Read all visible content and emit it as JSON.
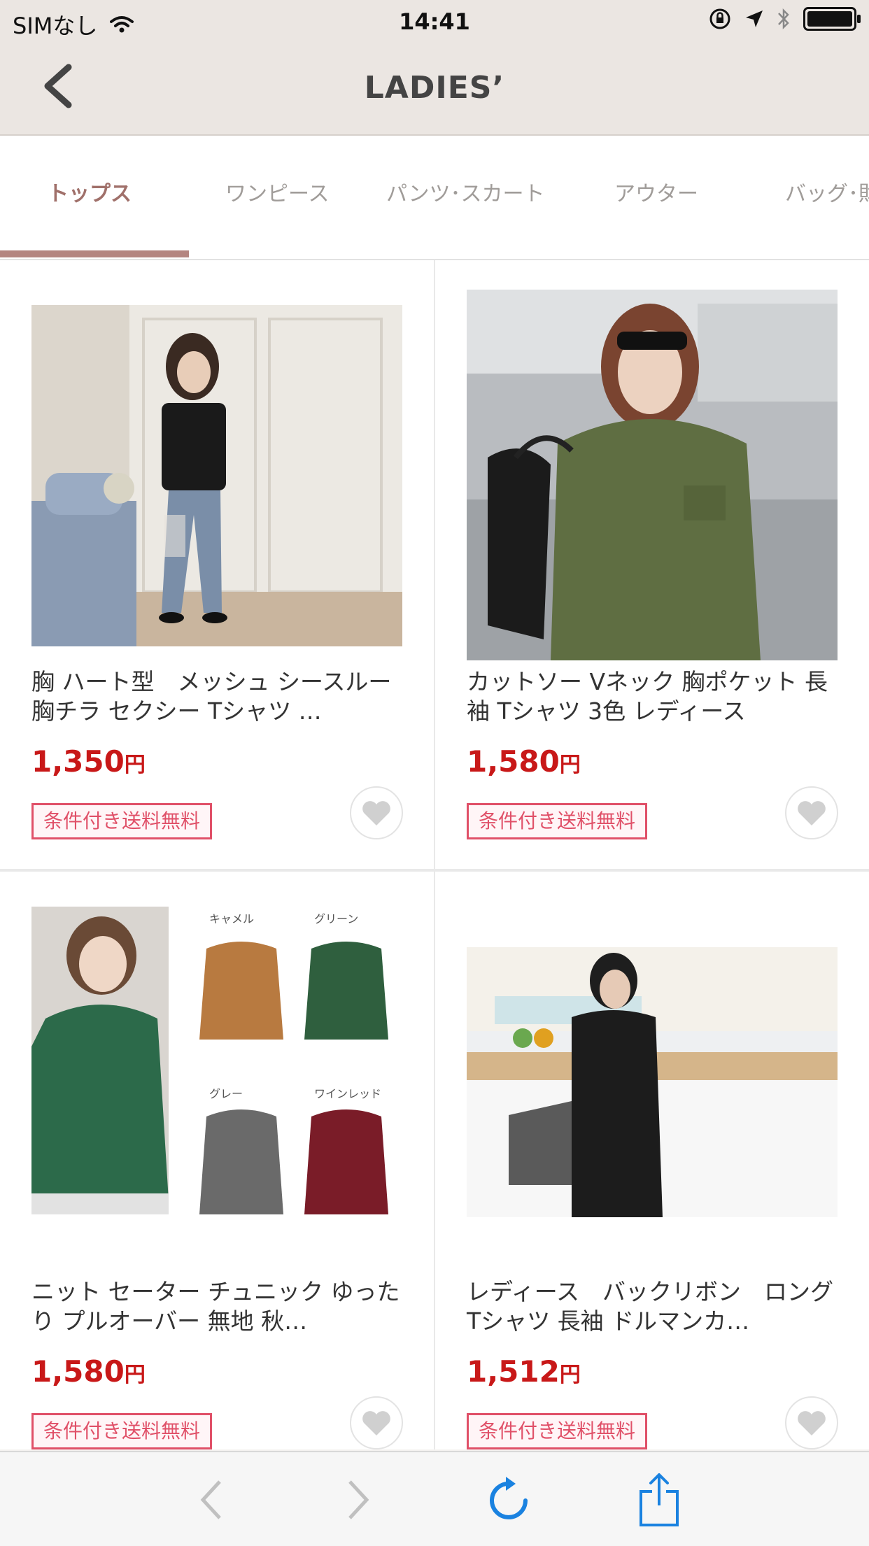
{
  "status": {
    "carrier": "SIMなし",
    "time": "14:41"
  },
  "nav": {
    "title": "LADIES’"
  },
  "tabs": [
    {
      "label": "トップス",
      "active": true
    },
    {
      "label": "ワンピース"
    },
    {
      "label": "パンツ･スカート"
    },
    {
      "label": "アウター"
    },
    {
      "label": "バッグ･財"
    }
  ],
  "products": [
    {
      "title": "胸 ハート型　メッシュ シースルー 胸チラ セクシー Tシャツ …",
      "price": "1,350",
      "currency": "円",
      "badge": "条件付き送料無料"
    },
    {
      "title": "カットソー Vネック 胸ポケット 長袖 Tシャツ 3色 レディース",
      "price": "1,580",
      "currency": "円",
      "badge": "条件付き送料無料"
    },
    {
      "title": "ニット セーター チュニック ゆったり プルオーバー 無地 秋…",
      "price": "1,580",
      "currency": "円",
      "badge": "条件付き送料無料",
      "swatch_labels": [
        "キャメル",
        "グリーン",
        "グレー",
        "ワインレッド"
      ]
    },
    {
      "title": "レディース　バックリボン　ロングTシャツ 長袖 ドルマンカ…",
      "price": "1,512",
      "currency": "円",
      "badge": "条件付き送料無料"
    }
  ],
  "colors": {
    "accent": "#b48580",
    "price": "#c81818",
    "badge": "#e05068",
    "ios_blue": "#1a82e0"
  },
  "battery_level": 1.0
}
